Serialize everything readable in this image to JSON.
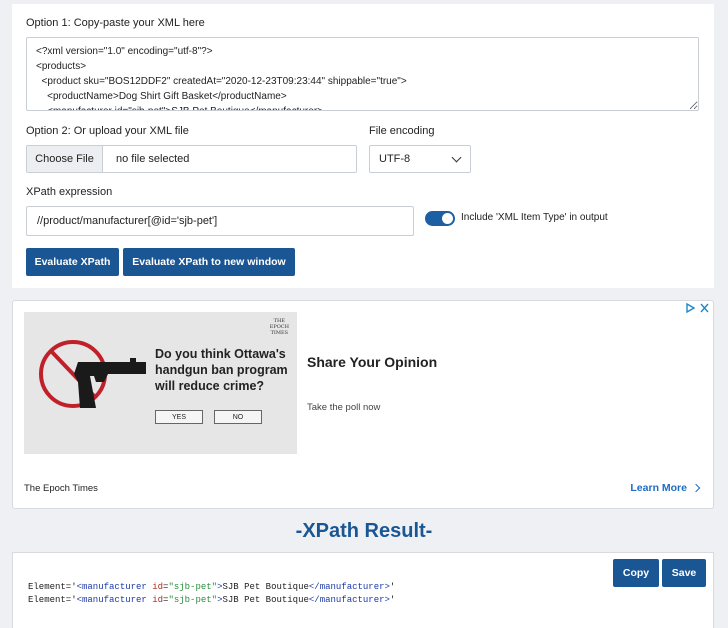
{
  "form": {
    "option1_label": "Option 1: Copy-paste your XML here",
    "xml_text": "<?xml version=\"1.0\" encoding=\"utf-8\"?>\n<products>\n  <product sku=\"BOS12DDF2\" createdAt=\"2020-12-23T09:23:44\" shippable=\"true\">\n    <productName>Dog Shirt Gift Basket</productName>\n    <manufacturer id=\"sjb-pet\">SJB Pet Boutique</manufacturer>",
    "option2_label": "Option 2: Or upload your XML file",
    "choose_file_label": "Choose File",
    "file_status": "no file selected",
    "encoding_label": "File encoding",
    "encoding_value": "UTF-8",
    "xpath_label": "XPath expression",
    "xpath_value": "//product/manufacturer[@id='sjb-pet']",
    "toggle_label": "Include 'XML Item Type' in output",
    "toggle_on": true,
    "evaluate_button": "Evaluate XPath",
    "evaluate_new_window_button": "Evaluate XPath to new window"
  },
  "ad": {
    "logo_line1": "THE",
    "logo_line2": "EPOCH",
    "logo_line3": "TIMES",
    "question": "Do you think Ottawa's handgun ban program will reduce crime?",
    "yes": "YES",
    "no": "NO",
    "title": "Share Your Opinion",
    "subtitle": "Take the poll now",
    "source": "The Epoch Times",
    "learn_more": "Learn More"
  },
  "result": {
    "heading": "-XPath Result-",
    "copy_button": "Copy",
    "save_button": "Save",
    "lines": [
      {
        "prefix": "Element='",
        "open_tag": "<manufacturer",
        "attr_name": "id",
        "eq": "=",
        "attr_val": "\"sjb-pet\"",
        "close_open": ">",
        "text": "SJB Pet Boutique",
        "close_tag": "</manufacturer>",
        "suffix": "'"
      },
      {
        "prefix": "Element='",
        "open_tag": "<manufacturer",
        "attr_name": "id",
        "eq": "=",
        "attr_val": "\"sjb-pet\"",
        "close_open": ">",
        "text": "SJB Pet Boutique",
        "close_tag": "</manufacturer>",
        "suffix": "'"
      }
    ]
  },
  "colors": {
    "accent": "#1b5694",
    "link": "#1e6bc4"
  }
}
